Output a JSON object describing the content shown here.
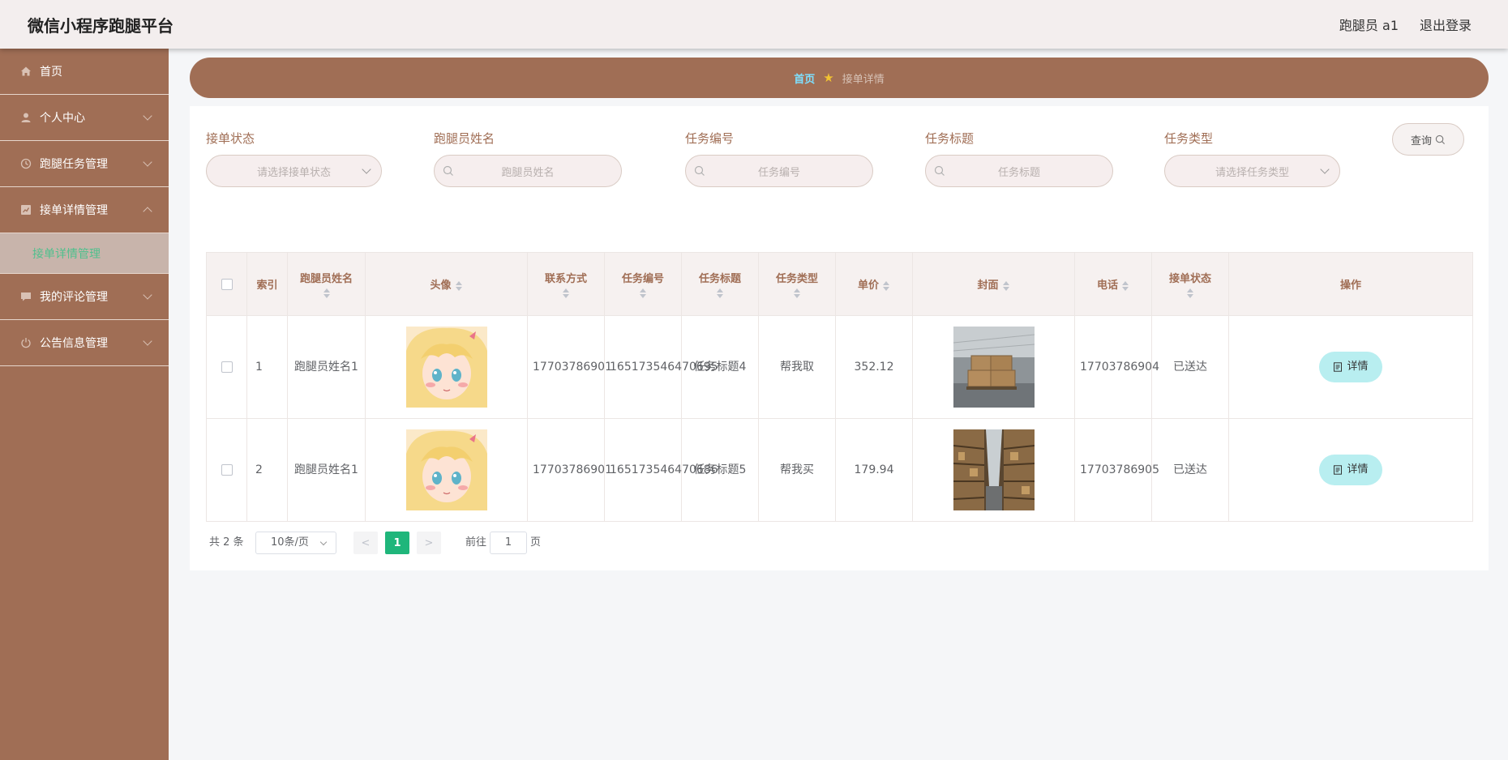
{
  "header": {
    "title": "微信小程序跑腿平台",
    "user": "跑腿员 a1",
    "logout": "退出登录"
  },
  "sidebar": {
    "items": [
      {
        "label": "首页",
        "icon": "home-icon"
      },
      {
        "label": "个人中心",
        "icon": "person-icon"
      },
      {
        "label": "跑腿任务管理",
        "icon": "clock-icon"
      },
      {
        "label": "接单详情管理",
        "icon": "chart-icon",
        "expanded": true
      },
      {
        "label": "我的评论管理",
        "icon": "comment-icon"
      },
      {
        "label": "公告信息管理",
        "icon": "power-icon"
      }
    ],
    "active_sub": "接单详情管理"
  },
  "breadcrumb": {
    "home": "首页",
    "separator": "★",
    "current": "接单详情"
  },
  "filters": {
    "status": {
      "label": "接单状态",
      "placeholder": "请选择接单状态"
    },
    "runner_name": {
      "label": "跑腿员姓名",
      "placeholder": "跑腿员姓名"
    },
    "task_no": {
      "label": "任务编号",
      "placeholder": "任务编号"
    },
    "task_title": {
      "label": "任务标题",
      "placeholder": "任务标题"
    },
    "task_type": {
      "label": "任务类型",
      "placeholder": "请选择任务类型"
    },
    "query_button": "查询"
  },
  "table": {
    "columns": [
      "索引",
      "跑腿员姓名",
      "头像",
      "联系方式",
      "任务编号",
      "任务标题",
      "任务类型",
      "单价",
      "封面",
      "电话",
      "接单状态",
      "操作"
    ],
    "rows": [
      {
        "index": "1",
        "runner_name": "跑腿员姓名1",
        "contact": "17703786901",
        "task_no": "165173546470695",
        "task_title": "任务标题4",
        "task_type": "帮我取",
        "price": "352.12",
        "phone": "17703786904",
        "status": "已送达",
        "action": "详情"
      },
      {
        "index": "2",
        "runner_name": "跑腿员姓名1",
        "contact": "17703786901",
        "task_no": "165173546470686",
        "task_title": "任务标题5",
        "task_type": "帮我买",
        "price": "179.94",
        "phone": "17703786905",
        "status": "已送达",
        "action": "详情"
      }
    ]
  },
  "pagination": {
    "total": "共 2 条",
    "page_size": "10条/页",
    "current_page": "1",
    "goto_prefix": "前往",
    "goto_value": "1",
    "goto_suffix": "页",
    "prev": "<",
    "next": ">"
  },
  "colors": {
    "brand": "#a06e55",
    "active_sub": "#4fc08d",
    "page_current": "#1fb67b",
    "detail_button": "#b8eef0"
  }
}
